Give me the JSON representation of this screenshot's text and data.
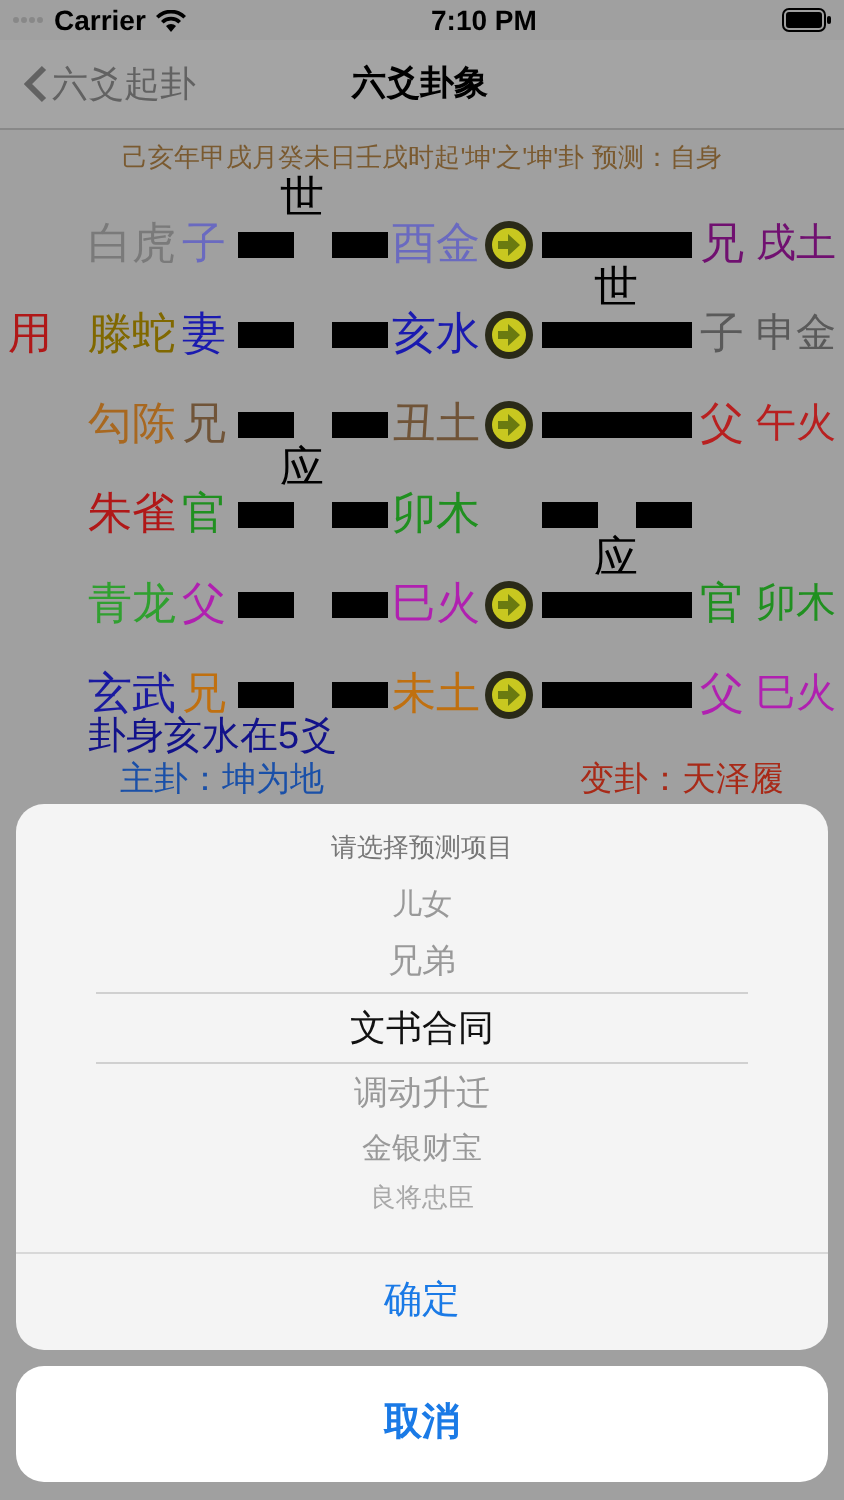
{
  "status_bar": {
    "carrier": "Carrier",
    "time": "7:10 PM"
  },
  "nav": {
    "back": "六爻起卦",
    "title": "六爻卦象"
  },
  "info": "己亥年甲戌月癸未日壬戌时起'坤'之'坤'卦 预测：自身",
  "yao": [
    {
      "spirit": {
        "text": "白虎",
        "color": "#7a7a7a"
      },
      "qin": "子",
      "najia": "酉金",
      "color": "#6a6ac0",
      "main_yin": true,
      "main_mark": "世",
      "moving": true,
      "changed_yin": false,
      "changed": {
        "qin": "兄",
        "najia": "戌土",
        "color": "#701070"
      }
    },
    {
      "prefix": "用",
      "spirit": {
        "text": "滕蛇",
        "color": "#806800"
      },
      "qin": "妻",
      "najia": "亥水",
      "color": "#1a1ab0",
      "main_yin": true,
      "moving": true,
      "changed_yin": false,
      "changed_mark": "世",
      "changed": {
        "qin": "子",
        "najia": "申金",
        "color": "#5a5a5a"
      }
    },
    {
      "spirit": {
        "text": "勾陈",
        "color": "#a86820"
      },
      "qin": "兄",
      "najia": "丑土",
      "color": "#705438",
      "main_yin": true,
      "moving": true,
      "changed_yin": false,
      "changed": {
        "qin": "父",
        "najia": "午火",
        "color": "#b82020"
      }
    },
    {
      "spirit": {
        "text": "朱雀",
        "color": "#b01818"
      },
      "qin": "官",
      "najia": "卯木",
      "color": "#209020",
      "main_yin": true,
      "main_mark": "应",
      "moving": false,
      "changed_yin": true
    },
    {
      "spirit": {
        "text": "青龙",
        "color": "#30a030"
      },
      "qin": "父",
      "najia": "巳火",
      "color": "#b020b0",
      "main_yin": true,
      "moving": true,
      "changed_yin": false,
      "changed_mark": "应",
      "changed": {
        "qin": "官",
        "najia": "卯木",
        "color": "#209020"
      }
    },
    {
      "spirit": {
        "text": "玄武",
        "color": "#1a1aa0"
      },
      "qin": "兄",
      "najia": "未土",
      "color": "#c07010",
      "main_yin": true,
      "moving": true,
      "changed_yin": false,
      "changed": {
        "qin": "父",
        "najia": "巳火",
        "color": "#b020b0"
      }
    }
  ],
  "gua_shen": "卦身亥水在5爻",
  "main_gua": "主卦：坤为地",
  "changed_gua": "变卦：天泽履",
  "sheet": {
    "title": "请选择预测项目",
    "options": [
      {
        "label": "儿女",
        "selected": false
      },
      {
        "label": "兄弟",
        "selected": false
      },
      {
        "label": "文书合同",
        "selected": true
      },
      {
        "label": "调动升迁",
        "selected": false
      },
      {
        "label": "金银财宝",
        "selected": false
      },
      {
        "label": "良将忠臣",
        "selected": false
      }
    ],
    "confirm": "确定",
    "cancel": "取消"
  }
}
